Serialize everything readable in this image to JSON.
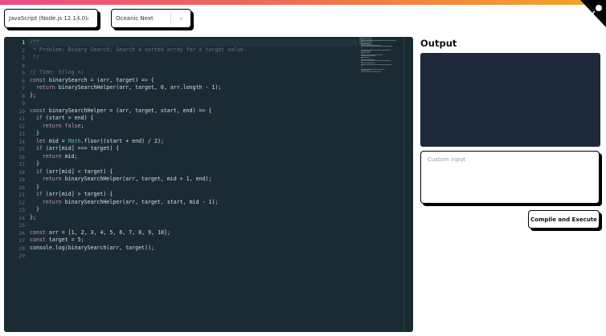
{
  "header": {
    "gradient_colors": [
      "#ec4c84",
      "#f5a623"
    ],
    "github_corner_icon": "github-octocat-icon"
  },
  "language_select": {
    "value": "JavaScript (Node.js 12.14.0)"
  },
  "theme_select": {
    "value": "Oceanic Next"
  },
  "editor": {
    "active_line": 1,
    "lines": [
      "/**",
      " * Problem: Binary Search: Search a sorted array for a target value.",
      " */",
      "",
      "// Time: O(log n)",
      "const binarySearch = (arr, target) => {",
      "  return binarySearchHelper(arr, target, 0, arr.length - 1);",
      "};",
      "",
      "const binarySearchHelper = (arr, target, start, end) => {",
      "  if (start > end) {",
      "    return false;",
      "  }",
      "  let mid = Math.floor((start + end) / 2);",
      "  if (arr[mid] === target) {",
      "    return mid;",
      "  }",
      "  if (arr[mid] < target) {",
      "    return binarySearchHelper(arr, target, mid + 1, end);",
      "  }",
      "  if (arr[mid] > target) {",
      "    return binarySearchHelper(arr, target, start, mid - 1);",
      "  }",
      "};",
      "",
      "const arr = [1, 2, 3, 4, 5, 6, 7, 8, 9, 10];",
      "const target = 5;",
      "console.log(binarySearch(arr, target));",
      ""
    ]
  },
  "output": {
    "title": "Output",
    "content": ""
  },
  "custom_input": {
    "placeholder": "Custom input",
    "value": ""
  },
  "compile_button": {
    "label": "Compile and Execute"
  }
}
